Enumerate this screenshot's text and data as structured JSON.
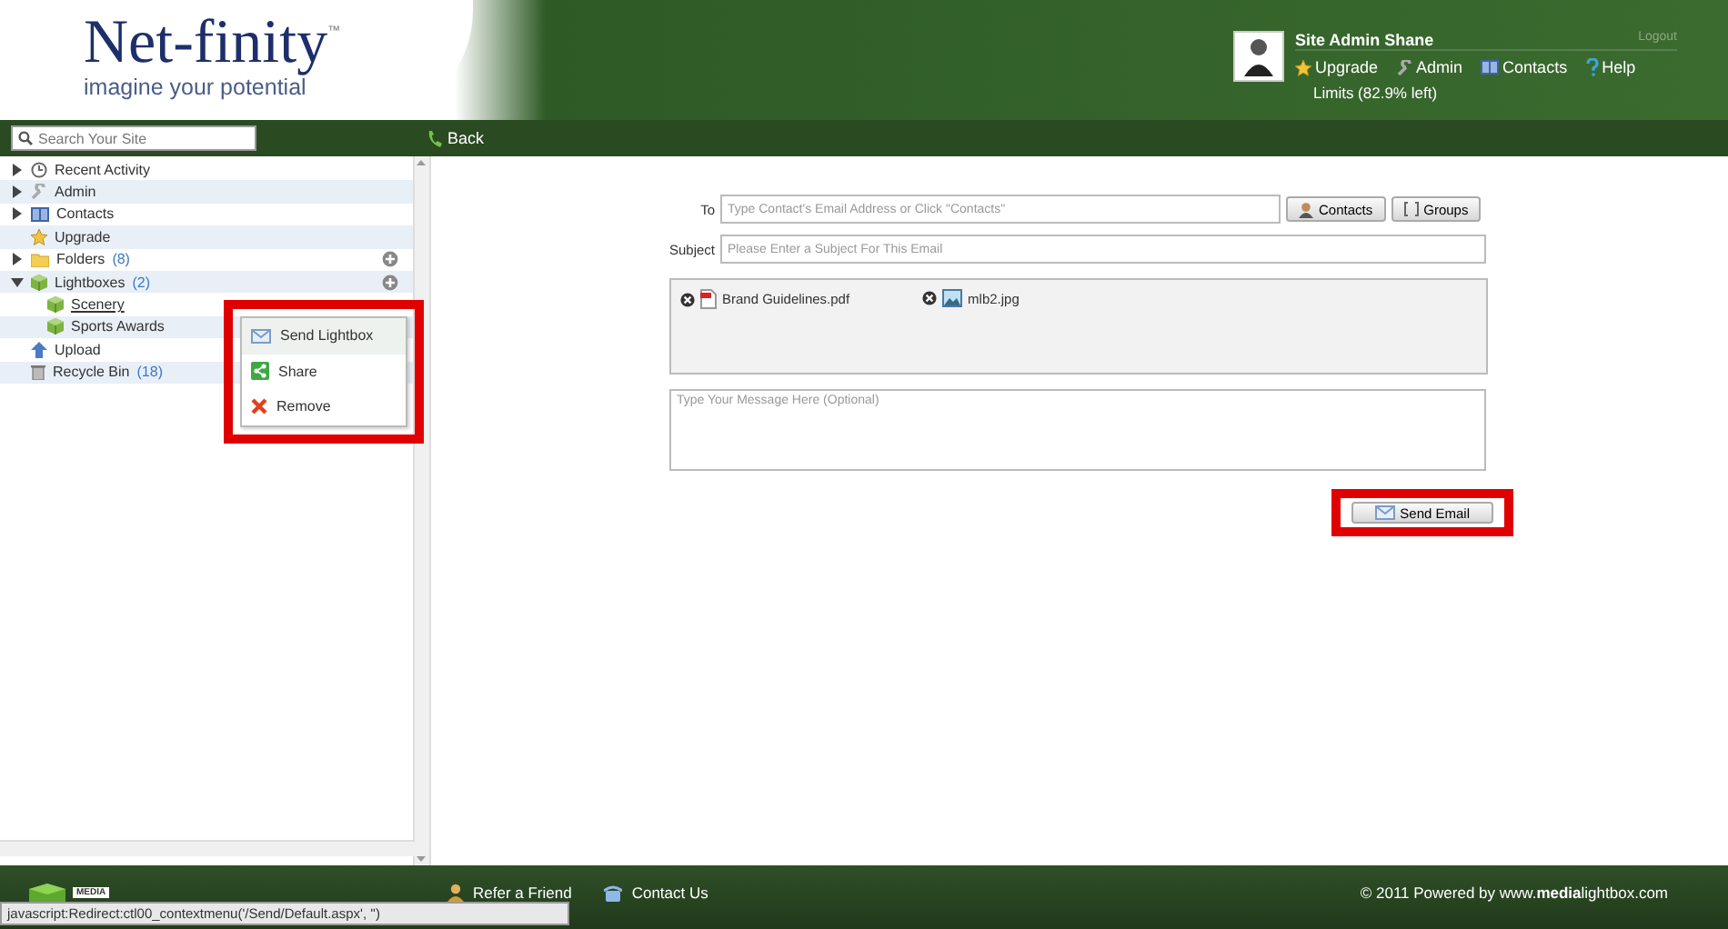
{
  "header": {
    "logo": "Net-finity",
    "trademark": "™",
    "tagline": "imagine your potential",
    "user_name": "Site Admin Shane",
    "logout": "Logout",
    "links": [
      "Upgrade",
      "Admin",
      "Contacts",
      "Help"
    ],
    "limits": "Limits (82.9% left)"
  },
  "toolbar": {
    "search_placeholder": "Search Your Site",
    "back": "Back"
  },
  "sidebar": {
    "items": [
      {
        "label": "Recent Activity",
        "expanded": false
      },
      {
        "label": "Admin",
        "expanded": false
      },
      {
        "label": "Contacts",
        "expanded": false
      },
      {
        "label": "Upgrade"
      },
      {
        "label": "Folders",
        "count": "(8)",
        "expanded": false,
        "add_button": true
      },
      {
        "label": "Lightboxes",
        "count": "(2)",
        "expanded": true,
        "add_button": true,
        "children": [
          {
            "label": "Scenery",
            "hovered": true
          },
          {
            "label": "Sports Awards",
            "hovered": false
          }
        ]
      },
      {
        "label": "Upload"
      },
      {
        "label": "Recycle Bin",
        "count": "(18)"
      }
    ]
  },
  "context_menu": {
    "items": [
      {
        "label": "Send Lightbox",
        "selected": true
      },
      {
        "label": "Share",
        "selected": false
      },
      {
        "label": "Remove",
        "selected": false
      }
    ],
    "highlighted": true
  },
  "email_form": {
    "to_label": "To",
    "to_placeholder": "Type Contact's Email Address or Click \"Contacts\"",
    "contacts_button": "Contacts",
    "groups_button": "Groups",
    "subject_label": "Subject",
    "subject_placeholder": "Please Enter a Subject For This Email",
    "attachments": [
      {
        "name": "Brand Guidelines.pdf",
        "kind": "pdf"
      },
      {
        "name": "mlb2.jpg",
        "kind": "image"
      }
    ],
    "message_placeholder": "Type Your Message Here (Optional)",
    "send_button": "Send Email",
    "send_highlighted": true
  },
  "footer": {
    "logo_label": "MEDIA",
    "links": [
      "Refer a Friend",
      "Contact Us"
    ],
    "copyright_prefix": "© 2011 Powered by www.",
    "copyright_bold": "media",
    "copyright_suffix": "lightbox.com"
  },
  "status_bar": "javascript:Redirect:ctl00_contextmenu('/Send/Default.aspx', '')"
}
